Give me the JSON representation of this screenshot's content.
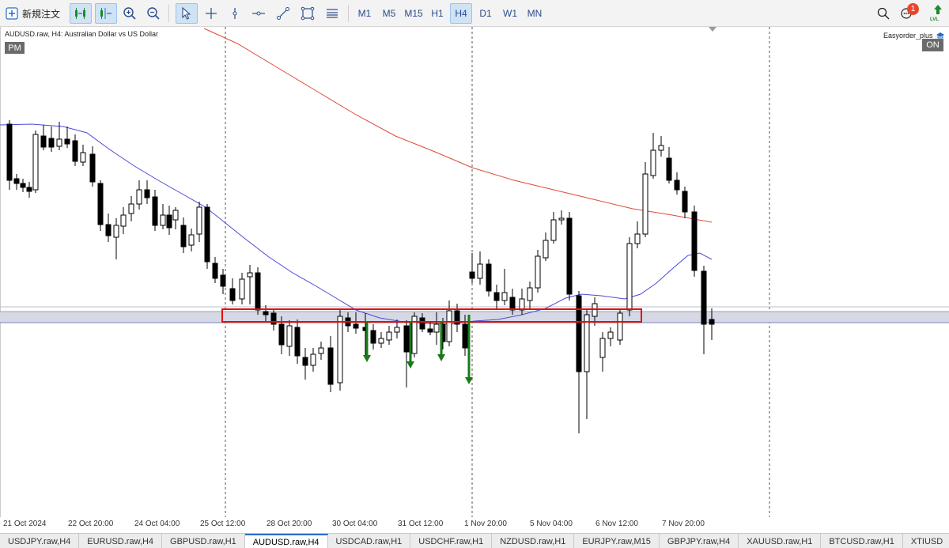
{
  "toolbar": {
    "new_order_label": "新規注文",
    "timeframes": [
      "M1",
      "M5",
      "M15",
      "H1",
      "H4",
      "D1",
      "W1",
      "MN"
    ],
    "active_timeframe": "H4",
    "notification_count": "1",
    "lvl_label": "LVL"
  },
  "chart": {
    "title": "AUDUSD.raw, H4:  Australian Dollar vs US Dollar",
    "pm_label": "PM",
    "on_label": "ON",
    "indicator_label": "Easyorder_plus",
    "colors": {
      "ma_fast": "#4a4ad8",
      "ma_slow": "#e04a3a",
      "zone_box": "#e01010",
      "arrow": "#1a7a1a"
    }
  },
  "time_axis": [
    "21 Oct 2024",
    "22 Oct 20:00",
    "24 Oct 04:00",
    "25 Oct 12:00",
    "28 Oct 20:00",
    "30 Oct 04:00",
    "31 Oct 12:00",
    "1 Nov 20:00",
    "5 Nov 04:00",
    "6 Nov 12:00",
    "7 Nov 20:00"
  ],
  "tabs": [
    "USDJPY.raw,H4",
    "EURUSD.raw,H4",
    "GBPUSD.raw,H1",
    "AUDUSD.raw,H4",
    "USDCAD.raw,H1",
    "USDCHF.raw,H1",
    "NZDUSD.raw,H1",
    "EURJPY.raw,M15",
    "GBPJPY.raw,H4",
    "XAUUSD.raw,H1",
    "BTCUSD.raw,H1",
    "XTIUSD"
  ],
  "active_tab": "AUDUSD.raw,H4"
}
